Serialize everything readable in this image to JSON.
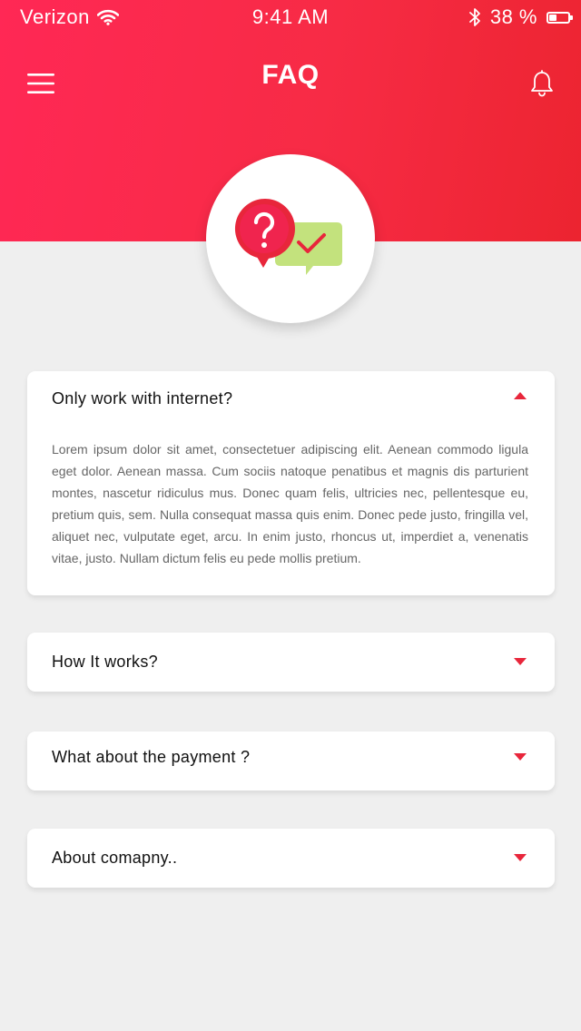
{
  "status_bar": {
    "carrier": "Verizon",
    "time": "9:41 AM",
    "battery_percent": "38 %",
    "battery_level": 0.38
  },
  "header": {
    "title": "FAQ"
  },
  "colors": {
    "brand": "#f72b45",
    "accent_red": "#e8263b",
    "check_green": "#c3e27d",
    "background": "#efefef"
  },
  "faq": [
    {
      "question": "Only work with internet?",
      "expanded": true,
      "answer": "Lorem ipsum dolor sit amet, consectetuer adipiscing elit. Aenean commodo ligula eget dolor. Aenean massa. Cum sociis natoque penatibus et magnis dis parturient montes, nascetur ridiculus mus. Donec quam felis, ultricies nec, pellentesque eu, pretium quis, sem. Nulla consequat massa quis enim. Donec pede justo, fringilla vel, aliquet nec, vulputate eget, arcu. In enim justo, rhoncus ut, imperdiet a, venenatis vitae, justo. Nullam dictum felis eu pede mollis pretium."
    },
    {
      "question": "How It works?",
      "expanded": false
    },
    {
      "question": "What about the payment ?",
      "expanded": false
    },
    {
      "question": "About comapny..",
      "expanded": false
    }
  ]
}
